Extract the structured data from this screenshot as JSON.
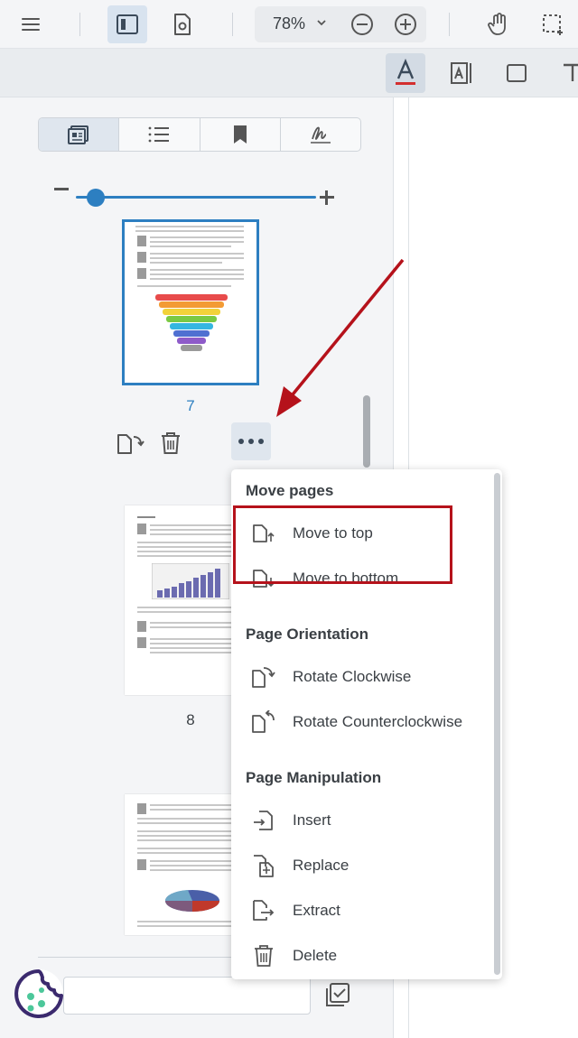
{
  "toolbar": {
    "zoom": "78%",
    "icons": [
      "menu-icon",
      "toggle-panel-icon",
      "settings-doc-icon",
      "chevron-down-icon",
      "zoom-out-icon",
      "zoom-in-icon",
      "pan-hand-icon",
      "select-region-icon"
    ]
  },
  "subtoolbar": {
    "icons": [
      "text-color-icon",
      "text-field-icon",
      "rectangle-icon",
      "text-icon"
    ],
    "accent": "#d32f2f"
  },
  "panel": {
    "tabs": [
      "thumbnails",
      "outline",
      "bookmarks",
      "signatures"
    ],
    "pages": [
      {
        "number": "7",
        "selected": true
      },
      {
        "number": "8",
        "selected": false
      },
      {
        "number": "",
        "selected": false
      }
    ]
  },
  "menu": {
    "sections": {
      "move": "Move pages",
      "orientation": "Page Orientation",
      "manipulation": "Page Manipulation"
    },
    "items": {
      "move_top": "Move to top",
      "move_bottom": "Move to bottom",
      "rotate_cw": "Rotate Clockwise",
      "rotate_ccw": "Rotate Counterclockwise",
      "insert": "Insert",
      "replace": "Replace",
      "extract": "Extract",
      "delete": "Delete"
    }
  },
  "colors": {
    "accent_blue": "#2d7fc1",
    "annotation_red": "#b5121b"
  }
}
